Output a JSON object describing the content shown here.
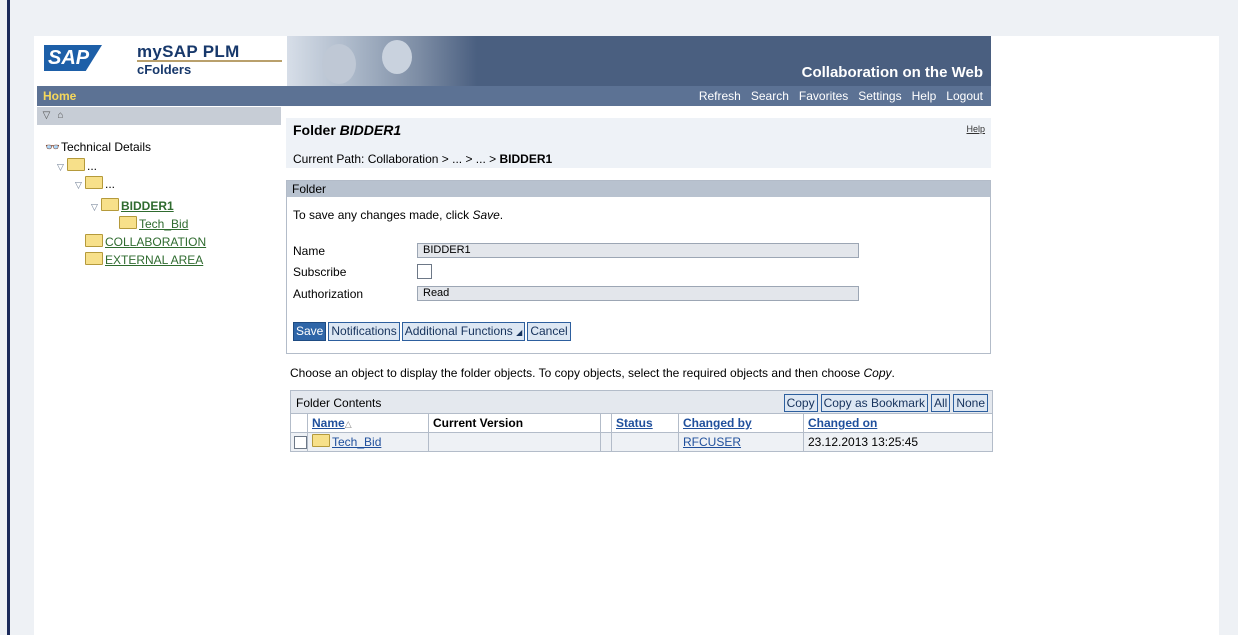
{
  "header": {
    "logo": "SAP",
    "product_title": "mySAP PLM",
    "product_subtitle": "cFolders",
    "tagline": "Collaboration on the Web"
  },
  "nav": {
    "home": "Home",
    "links": [
      "Refresh",
      "Search",
      "Favorites",
      "Settings",
      "Help",
      "Logout"
    ]
  },
  "tree": {
    "root": "Technical Details",
    "level1": "...",
    "level2": "...",
    "current": "BIDDER1",
    "child": "Tech_Bid",
    "collaboration": "COLLABORATION",
    "external": "EXTERNAL AREA"
  },
  "main": {
    "title_prefix": "Folder",
    "title_name": "BIDDER1",
    "help": "Help",
    "path_label": "Current Path:",
    "path_value": "Collaboration > ... > ... >",
    "path_current": "BIDDER1"
  },
  "folder_panel": {
    "heading": "Folder",
    "save_note_prefix": "To save any changes made, click",
    "save_note_action": "Save",
    "fields": {
      "name_label": "Name",
      "name_value": "BIDDER1",
      "subscribe_label": "Subscribe",
      "subscribe_checked": false,
      "authorization_label": "Authorization",
      "authorization_value": "Read"
    },
    "buttons": {
      "save": "Save",
      "notifications": "Notifications",
      "additional": "Additional Functions",
      "cancel": "Cancel"
    }
  },
  "choose_note": {
    "text": "Choose an object to display the folder objects. To copy objects, select the required objects and then choose",
    "action": "Copy"
  },
  "contents": {
    "title": "Folder Contents",
    "buttons": {
      "copy": "Copy",
      "copy_bookmark": "Copy as Bookmark",
      "all": "All",
      "none": "None"
    },
    "columns": [
      "Name",
      "Current Version",
      "Status",
      "Changed by",
      "Changed on"
    ],
    "rows": [
      {
        "name": "Tech_Bid",
        "version": "",
        "status": "",
        "changed_by": "RFCUSER",
        "changed_on": "23.12.2013 13:25:45"
      }
    ]
  },
  "colors": {
    "header_bg": "#4a5f80",
    "nav_bg": "#5c7294",
    "home": "#f6d85b",
    "tree_link": "#2f6b2f",
    "table_link": "#1f4f9c"
  }
}
